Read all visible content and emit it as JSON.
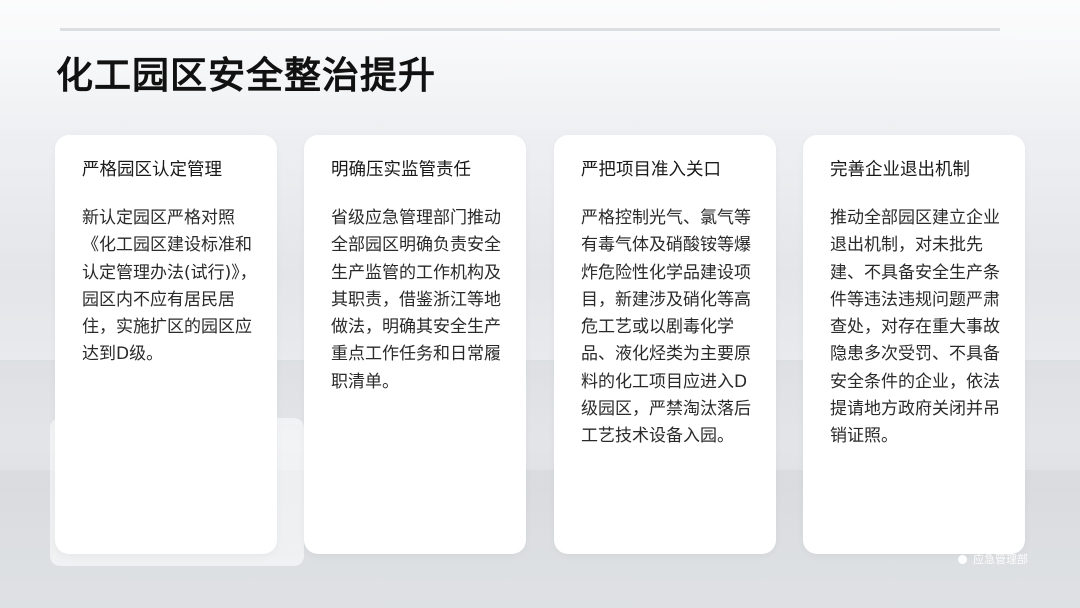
{
  "slide": {
    "title": "化工园区安全整治提升"
  },
  "cards": [
    {
      "heading": "严格园区认定管理",
      "body": "新认定园区严格对照《化工园区建设标准和认定管理办法(试行)》，园区内不应有居民居住，实施扩区的园区应达到D级。"
    },
    {
      "heading": "明确压实监管责任",
      "body": "省级应急管理部门推动全部园区明确负责安全生产监管的工作机构及其职责，借鉴浙江等地做法，明确其安全生产重点工作任务和日常履职清单。"
    },
    {
      "heading": "严把项目准入关口",
      "body": "严格控制光气、氯气等有毒气体及硝酸铵等爆炸危险性化学品建设项目，新建涉及硝化等高危工艺或以剧毒化学品、液化烃类为主要原料的化工项目应进入D级园区，严禁淘汰落后工艺技术设备入园。"
    },
    {
      "heading": "完善企业退出机制",
      "body": "推动全部园区建立企业退出机制，对未批先建、不具备安全生产条件等违法违规问题严肃查处，对存在重大事故隐患多次受罚、不具备安全条件的企业，依法提请地方政府关闭并吊销证照。"
    }
  ],
  "watermark": {
    "text": "应急管理部"
  }
}
